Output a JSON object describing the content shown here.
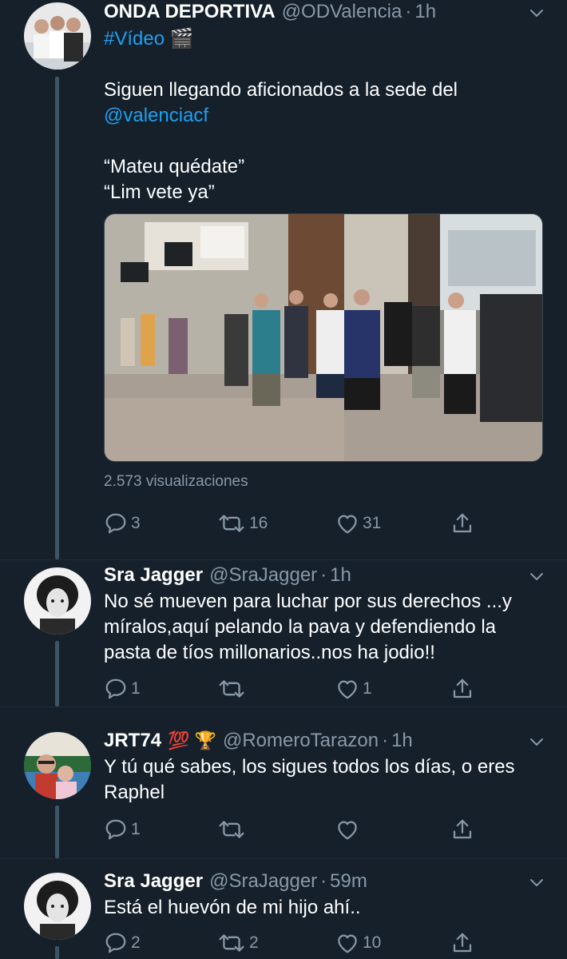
{
  "tweets": [
    {
      "name": "ONDA DEPORTIVA",
      "handle": "@ODValencia",
      "time": "1h",
      "hashtag": "#Vídeo",
      "hashtag_emoji": "🎬",
      "line1": "Siguen llegando aficionados a la sede del",
      "mention": "@valenciacf",
      "quote1": "“Mateu quédate”",
      "quote2": "“Lim vete ya”",
      "views": "2.573 visualizaciones",
      "replies": "3",
      "retweets": "16",
      "likes": "31"
    },
    {
      "name": "Sra Jagger",
      "handle": "@SraJagger",
      "time": "1h",
      "text": "No sé mueven para luchar por sus derechos ...y míralos,aquí pelando la pava y defendiendo la pasta de tíos millonarios..nos ha jodio!!",
      "replies": "1",
      "retweets": "",
      "likes": "1"
    },
    {
      "name": "JRT74",
      "badges": "💯 🏆",
      "handle": "@RomeroTarazon",
      "time": "1h",
      "text": "Y tú qué sabes, los sigues todos los días, o eres Raphel",
      "replies": "1",
      "retweets": "",
      "likes": ""
    },
    {
      "name": "Sra Jagger",
      "handle": "@SraJagger",
      "time": "59m",
      "text": "Está el huevón de mi hijo ahí..",
      "replies": "2",
      "retweets": "2",
      "likes": "10"
    }
  ],
  "icons": {
    "reply": "reply-icon",
    "retweet": "retweet-icon",
    "like": "heart-icon",
    "share": "share-icon",
    "more": "chevron-down-icon"
  },
  "colors": {
    "background": "#15202b",
    "link": "#1da1f2",
    "secondary": "#8899a6",
    "thread": "#3d5466"
  }
}
